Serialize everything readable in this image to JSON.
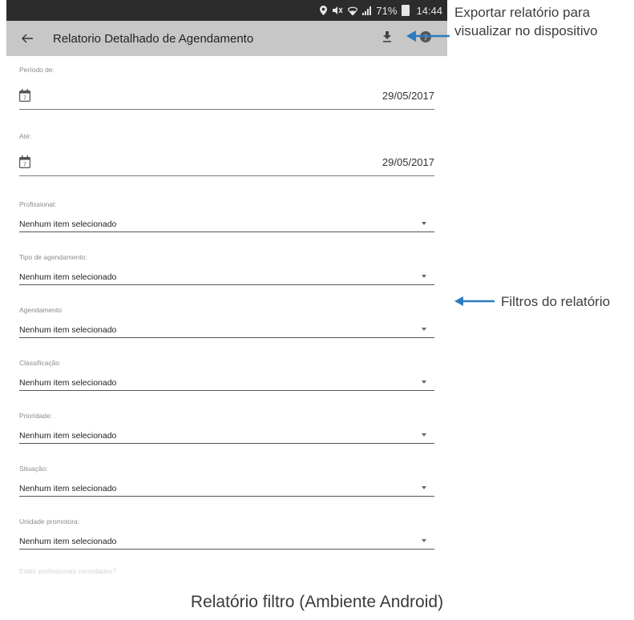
{
  "status_bar": {
    "battery": "71%",
    "time": "14:44"
  },
  "app_bar": {
    "back_icon": "arrow-left-icon",
    "title": "Relatorio Detalhado de Agendamento",
    "actions": [
      "download-icon",
      "help-icon"
    ]
  },
  "date_fields": [
    {
      "label": "Período de:",
      "value": "29/05/2017",
      "icon": "calendar-icon"
    },
    {
      "label": "Até:",
      "value": "29/05/2017",
      "icon": "calendar-icon"
    }
  ],
  "select_fields": [
    {
      "label": "Profissional:",
      "value": "Nenhum item selecionado"
    },
    {
      "label": "Tipo de agendamento:",
      "value": "Nenhum item selecionado"
    },
    {
      "label": "Agendamento",
      "value": "Nenhum item selecionado"
    },
    {
      "label": "Classificação",
      "value": "Nenhum item selecionado"
    },
    {
      "label": "Prioridade:",
      "value": "Nenhum item selecionado"
    },
    {
      "label": "Situação:",
      "value": "Nenhum item selecionado"
    },
    {
      "label": "Unidade promotora:",
      "value": "Nenhum item selecionado"
    }
  ],
  "partial_label": "Exibir profissionais convidados?",
  "annotations": {
    "export_line1": "Exportar relatório para",
    "export_line2": "visualizar no dispositivo",
    "filters": "Filtros do relatório",
    "caption": "Relatório filtro (Ambiente Android)",
    "arrow_color": "#2a7bbf"
  },
  "colors": {
    "app_bar": "#c7c7c7",
    "status_bar": "#2c2c2c"
  }
}
